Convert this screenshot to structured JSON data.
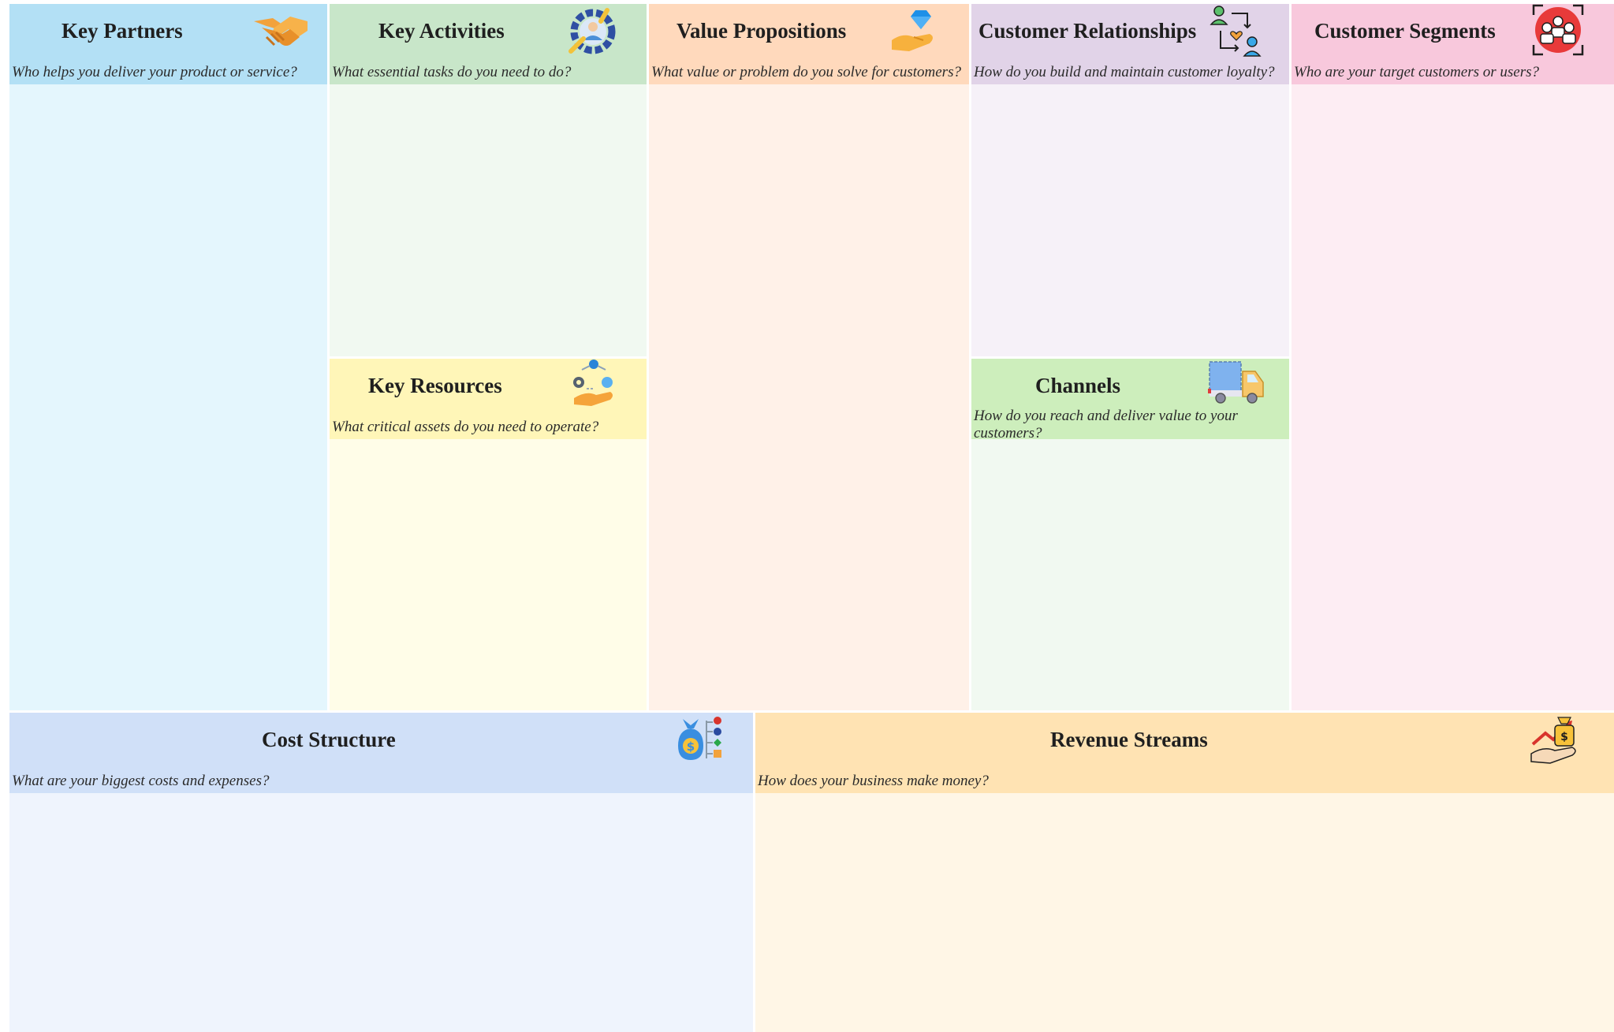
{
  "blocks": {
    "key_partners": {
      "title": "Key Partners",
      "question": "Who helps you deliver your product or service?",
      "icon": "handshake-icon",
      "header_color": "#b3e0f5",
      "body_color": "#e4f6fd"
    },
    "key_activities": {
      "title": "Key Activities",
      "question": "What essential tasks do you need to do?",
      "icon": "gear-worker-icon",
      "header_color": "#c8e6c9",
      "body_color": "#f1f9f1"
    },
    "key_resources": {
      "title": "Key Resources",
      "question": "What critical assets do you need to operate?",
      "icon": "resources-hand-icon",
      "header_color": "#fff6b8",
      "body_color": "#fffde8"
    },
    "value_propositions": {
      "title": "Value Propositions",
      "question": "What value or problem do you solve for customers?",
      "icon": "diamond-hand-icon",
      "header_color": "#ffd9bc",
      "body_color": "#fff1e8"
    },
    "customer_relationships": {
      "title": "Customer Relationships",
      "question": "How do you build and maintain customer loyalty?",
      "icon": "people-heart-icon",
      "header_color": "#e1d3e8",
      "body_color": "#f6f1f8"
    },
    "channels": {
      "title": "Channels",
      "question": "How do you reach and deliver value to your customers?",
      "icon": "delivery-truck-icon",
      "header_color": "#cdeebc",
      "body_color": "#f1f9f1"
    },
    "customer_segments": {
      "title": "Customer Segments",
      "question": "Who are your target customers or users?",
      "icon": "target-group-icon",
      "header_color": "#f8c8dc",
      "body_color": "#fdedf3"
    },
    "cost_structure": {
      "title": "Cost Structure",
      "question": "What are your biggest costs and expenses?",
      "icon": "money-bag-chart-icon",
      "header_color": "#d0e0f8",
      "body_color": "#eff4fd"
    },
    "revenue_streams": {
      "title": "Revenue Streams",
      "question": "How does your business make money?",
      "icon": "money-growth-icon",
      "header_color": "#ffe3b3",
      "body_color": "#fff6e6"
    }
  }
}
